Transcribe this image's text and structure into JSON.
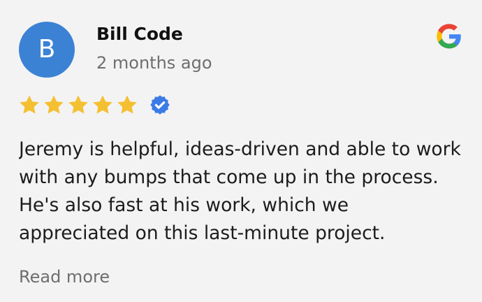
{
  "review": {
    "reviewer_initial": "B",
    "reviewer_name": "Bill Code",
    "time_ago": "2 months ago",
    "rating": 5,
    "max_rating": 5,
    "text": "Jeremy is helpful, ideas-driven and able to work with any bumps that come up in the process. He's also fast at his work, which we appreciated on this last-minute project.",
    "read_more_label": "Read more"
  },
  "icons": {
    "source": "google-g-icon",
    "star": "star-icon",
    "verified": "verified-badge-icon"
  },
  "colors": {
    "avatar_bg": "#3b82d4",
    "star": "#f4c032",
    "verified": "#3b7be8",
    "card_bg": "#f3f3f3"
  }
}
